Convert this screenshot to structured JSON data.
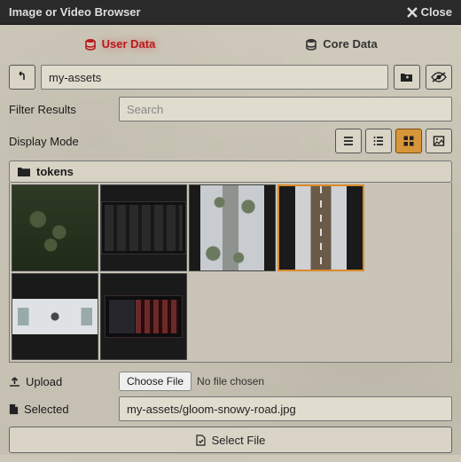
{
  "title": "Image or Video Browser",
  "close_label": "Close",
  "tabs": {
    "user": "User Data",
    "core": "Core Data",
    "active": "user"
  },
  "path": {
    "value": "my-assets"
  },
  "filter": {
    "label": "Filter Results",
    "placeholder": "Search",
    "value": ""
  },
  "display": {
    "label": "Display Mode",
    "active": "tiles"
  },
  "directory": {
    "name": "tokens"
  },
  "files": [
    {
      "id": "forest-clearing",
      "selected": false,
      "thumb": "th-forest"
    },
    {
      "id": "city-night",
      "selected": false,
      "thumb": "th-city"
    },
    {
      "id": "snowy-path",
      "selected": false,
      "thumb": "th-snow1"
    },
    {
      "id": "gloom-snowy-road",
      "selected": true,
      "thumb": "th-road"
    },
    {
      "id": "snow-bridge",
      "selected": false,
      "thumb": "th-snow2"
    },
    {
      "id": "derelict-ship",
      "selected": false,
      "thumb": "th-ship"
    }
  ],
  "upload": {
    "label": "Upload",
    "choose_btn": "Choose File",
    "status": "No file chosen"
  },
  "selected": {
    "label": "Selected",
    "value": "my-assets/gloom-snowy-road.jpg"
  },
  "select_file_btn": "Select File"
}
